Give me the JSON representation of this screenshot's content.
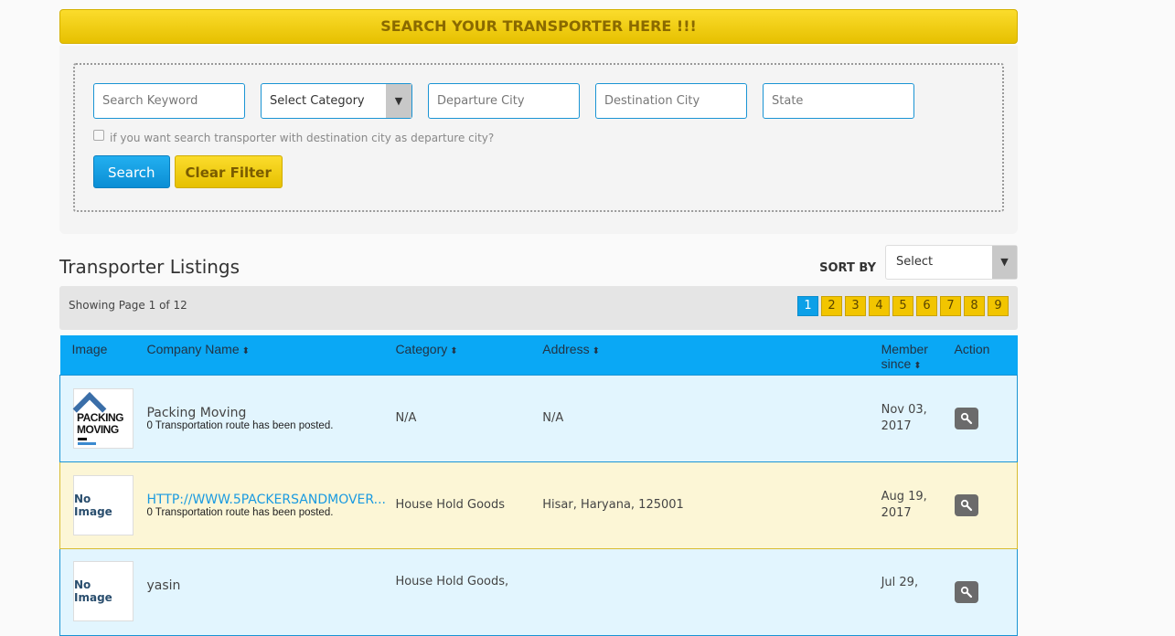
{
  "banner": {
    "title": "SEARCH YOUR TRANSPORTER HERE !!!"
  },
  "search": {
    "keyword_placeholder": "Search Keyword",
    "category_selected": "Select Category",
    "departure_placeholder": "Departure City",
    "destination_placeholder": "Destination City",
    "state_placeholder": "State",
    "checkbox_label": "if you want search transporter with destination city as departure city?",
    "checkbox_checked": false,
    "search_button": "Search",
    "clear_button": "Clear Filter"
  },
  "listings": {
    "title": "Transporter Listings",
    "sort_label": "SORT BY",
    "sort_selected": "Select",
    "pager_text": "Showing Page 1 of 12",
    "pages": [
      "1",
      "2",
      "3",
      "4",
      "5",
      "6",
      "7",
      "8",
      "9"
    ],
    "active_page": "1"
  },
  "table": {
    "headers": {
      "image": "Image",
      "company": "Company Name",
      "category": "Category",
      "address": "Address",
      "member_since_1": "Member",
      "member_since_2": "since",
      "action": "Action"
    },
    "sort_icon": "⬍",
    "rows": [
      {
        "image": "logo",
        "logo_text_1": "PACKING",
        "logo_text_2": "MOVING",
        "company": "Packing Moving",
        "note": "0 Transportation route has been posted.",
        "category": "N/A",
        "address": "N/A",
        "date_1": "Nov 03,",
        "date_2": "2017"
      },
      {
        "image": "No Image",
        "company": "HTTP://WWW.5PACKERSANDMOVER...",
        "note": "0 Transportation route has been posted.",
        "category": "House Hold Goods",
        "address": "Hisar, Haryana, 125001",
        "date_1": "Aug 19,",
        "date_2": "2017"
      },
      {
        "image": "No Image",
        "company": "yasin",
        "note": "",
        "category": "House Hold Goods,",
        "address": "",
        "date_1": "Jul 29,",
        "date_2": ""
      }
    ]
  },
  "icons": {
    "dropdown": "▼",
    "view": "search-icon"
  }
}
